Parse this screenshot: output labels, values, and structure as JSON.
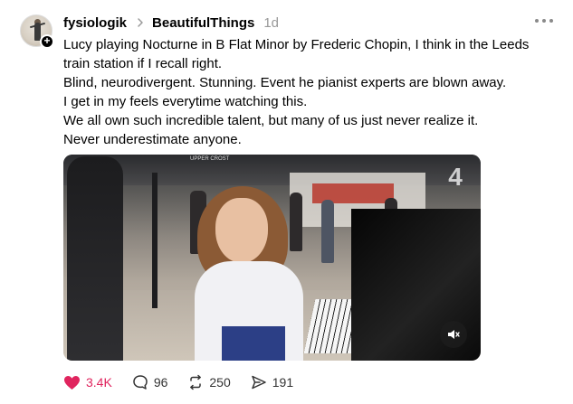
{
  "post": {
    "username": "fysiologik",
    "community": "BeautifulThings",
    "time": "1d",
    "lines": [
      "Lucy playing Nocturne in B Flat Minor by Frederic Chopin, I think in the Leeds",
      "train station if I recall right.",
      "Blind, neurodivergent. Stunning. Event he pianist experts are blown away.",
      "I get in my feels everytime watching this.",
      "We all own such incredible talent, but many of us just never realize it.",
      "Never underestimate anyone."
    ],
    "media": {
      "overlay_sign": "UPPER CROST",
      "channel_logo": "4"
    }
  },
  "actions": {
    "likes": "3.4K",
    "replies": "96",
    "reposts": "250",
    "shares": "191"
  },
  "colors": {
    "like_accent": "#e0245e",
    "muted_text": "#999999"
  },
  "icons": {
    "avatar_badge": "plus-icon",
    "header_separator": "chevron-right-icon",
    "menu": "more-icon",
    "media_control": "mute-icon",
    "like": "heart-icon",
    "reply": "comment-icon",
    "repost": "repost-icon",
    "share": "share-icon"
  }
}
